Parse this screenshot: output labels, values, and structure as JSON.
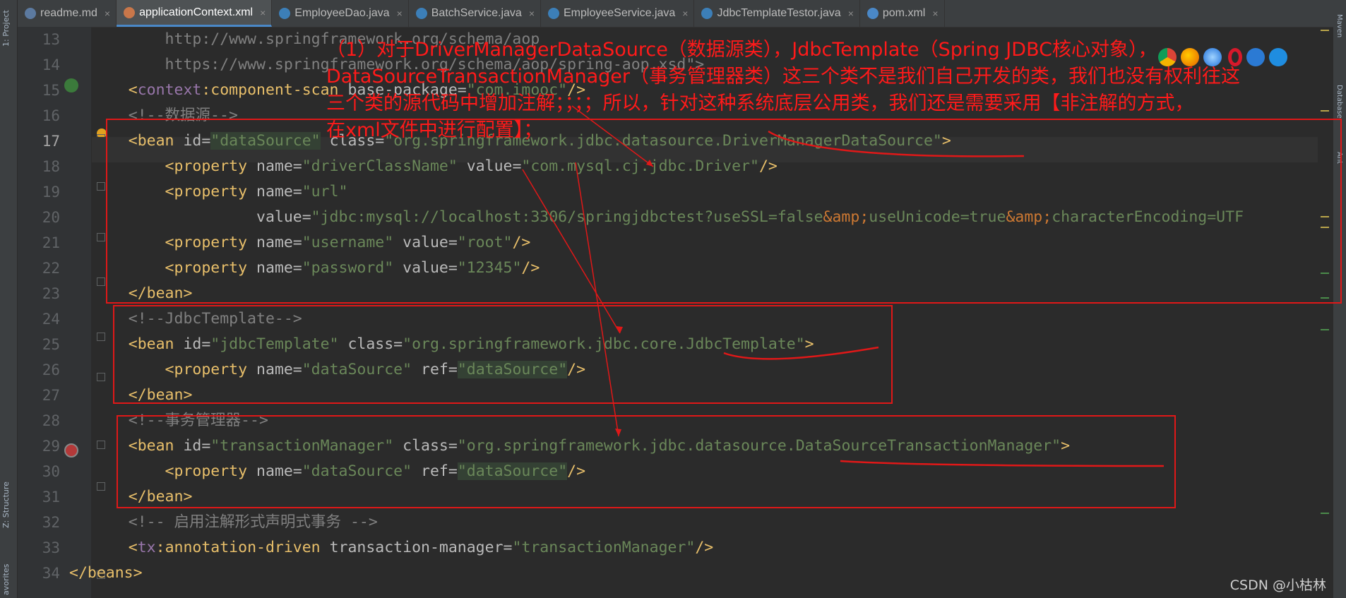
{
  "tool_strip": {
    "project_tab": "1: Project",
    "structure_tab": "Z: Structure",
    "favorites_tab": "avorites"
  },
  "right_strip": {
    "maven_tab": "Maven",
    "database_tab": "Database",
    "ant_tab": "Ant"
  },
  "tabs": [
    {
      "label": "readme.md",
      "icon": "md-file-icon",
      "color": "#5c7aa0",
      "active": false
    },
    {
      "label": "applicationContext.xml",
      "icon": "xml-file-icon",
      "color": "#c9774a",
      "active": true
    },
    {
      "label": "EmployeeDao.java",
      "icon": "java-class-icon",
      "color": "#3c7fb8",
      "active": false
    },
    {
      "label": "BatchService.java",
      "icon": "java-class-icon",
      "color": "#3c7fb8",
      "active": false
    },
    {
      "label": "EmployeeService.java",
      "icon": "java-class-icon",
      "color": "#3c7fb8",
      "active": false
    },
    {
      "label": "JdbcTemplateTestor.java",
      "icon": "java-test-class-icon",
      "color": "#3c7fb8",
      "active": false
    },
    {
      "label": "pom.xml",
      "icon": "maven-m-icon",
      "color": "#4a88c7",
      "active": false
    }
  ],
  "tab_close_glyph": "×",
  "line_numbers": [
    "13",
    "14",
    "15",
    "16",
    "17",
    "18",
    "19",
    "20",
    "21",
    "22",
    "23",
    "24",
    "25",
    "26",
    "27",
    "28",
    "29",
    "30",
    "31",
    "32",
    "33",
    "34"
  ],
  "code": {
    "l13": "        http://www.springframework.org/schema/aop",
    "l14": "        https://www.springframework.org/schema/aop/spring-aop.xsd\">",
    "l15_indent": "    <",
    "l15_ns": "context",
    "l15_tag": ":component-scan",
    "l15_attr": " base-package=",
    "l15_val": "\"com.imooc\"",
    "l15_end": "/>",
    "l16": "    <!--数据源-->",
    "l17_a": "    <bean ",
    "l17_b": "id=",
    "l17_c": "\"dataSource\"",
    "l17_d": " class=",
    "l17_e": "\"org.springframework.jdbc.datasource.DriverManagerDataSource\"",
    "l17_f": ">",
    "l18_a": "        <property ",
    "l18_b": "name=",
    "l18_c": "\"driverClassName\"",
    "l18_d": " value=",
    "l18_e": "\"com.mysql.cj.jdbc.Driver\"",
    "l18_f": "/>",
    "l19_a": "        <property ",
    "l19_b": "name=",
    "l19_c": "\"url\"",
    "l20_pad": "                  ",
    "l20_b": "value=",
    "l20_c": "\"jdbc:mysql://localhost:3306/springjdbctest?useSSL=false",
    "l20_amp1": "&amp;",
    "l20_d": "useUnicode=true",
    "l20_amp2": "&amp;",
    "l20_e": "characterEncoding=UTF",
    "l21_a": "        <property ",
    "l21_b": "name=",
    "l21_c": "\"username\"",
    "l21_d": " value=",
    "l21_e": "\"root\"",
    "l21_f": "/>",
    "l22_a": "        <property ",
    "l22_b": "name=",
    "l22_c": "\"password\"",
    "l22_d": " value=",
    "l22_e": "\"12345\"",
    "l22_f": "/>",
    "l23": "    </bean>",
    "l24": "    <!--JdbcTemplate-->",
    "l25_a": "    <bean ",
    "l25_b": "id=",
    "l25_c": "\"jdbcTemplate\"",
    "l25_d": " class=",
    "l25_e": "\"org.springframework.jdbc.core.JdbcTemplate\"",
    "l25_f": ">",
    "l26_a": "        <property ",
    "l26_b": "name=",
    "l26_c": "\"dataSource\"",
    "l26_d": " ref=",
    "l26_e": "\"dataSource\"",
    "l26_f": "/>",
    "l27": "    </bean>",
    "l28": "    <!--事务管理器-->",
    "l29_a": "    <bean ",
    "l29_b": "id=",
    "l29_c": "\"transactionManager\"",
    "l29_d": " class=",
    "l29_e": "\"org.springframework.jdbc.datasource.DataSourceTransactionManager\"",
    "l29_f": ">",
    "l30_a": "        <property ",
    "l30_b": "name=",
    "l30_c": "\"dataSource\"",
    "l30_d": " ref=",
    "l30_e": "\"dataSource\"",
    "l30_f": "/>",
    "l31": "    </bean>",
    "l32": "    <!-- 启用注解形式声明式事务 -->",
    "l33_a": "    <",
    "l33_ns": "tx",
    "l33_tag": ":annotation-driven ",
    "l33_attr": "transaction-manager=",
    "l33_val": "\"transactionManager\"",
    "l33_end": "/>",
    "l34": "</beans>"
  },
  "annotation": {
    "line1": "（1）对于DriverManagerDataSource（数据源类），JdbcTemplate（Spring JDBC核心对象），",
    "line2": "DataSourceTransactionManager（事务管理器类）这三个类不是我们自己开发的类，我们也没有权利往这",
    "line3": "三个类的源代码中增加注解；；；；所以，针对这种系统底层公用类，我们还是需要采用【非注解的方式，",
    "line4": "在xml文件中进行配置】；"
  },
  "colors": {
    "annotation_red": "#ff1a1a",
    "editor_bg": "#2b2b2b",
    "tag": "#e8bf6a",
    "string": "#6a8759",
    "comment": "#808080"
  },
  "browser_icons": [
    "chrome-icon",
    "firefox-icon",
    "safari-icon",
    "opera-icon",
    "ie-icon",
    "edge-icon"
  ],
  "watermark": "CSDN @小枯林"
}
